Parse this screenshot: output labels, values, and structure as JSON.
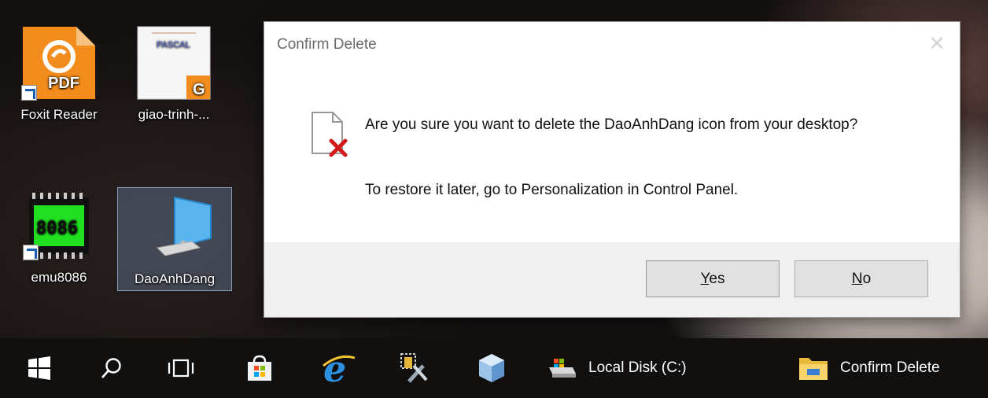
{
  "desktop": {
    "icons": [
      {
        "label": "Foxit Reader",
        "icon": "foxit-pdf-icon"
      },
      {
        "label": "giao-trinh-...",
        "icon": "document-thumbnail-icon",
        "thumb_text": "PASCAL"
      },
      {
        "label": "emu8086",
        "icon": "chip-8086-icon",
        "chip_text": "8086"
      },
      {
        "label": "DaoAnhDang",
        "icon": "computer-icon"
      }
    ]
  },
  "dialog": {
    "title": "Confirm Delete",
    "close_icon": "close-icon",
    "message": "Are you sure you want to delete the DaoAnhDang icon from your desktop?",
    "message2": "To restore it later, go to Personalization in Control Panel.",
    "icon": "delete-file-icon",
    "buttons": {
      "yes_accel": "Y",
      "yes_rest": "es",
      "no_accel": "N",
      "no_rest": "o"
    }
  },
  "taskbar": {
    "items": [
      {
        "icon": "windows-start-icon"
      },
      {
        "icon": "search-icon"
      },
      {
        "icon": "task-view-icon"
      },
      {
        "icon": "store-icon"
      },
      {
        "icon": "internet-explorer-icon"
      },
      {
        "icon": "tools-icon"
      },
      {
        "icon": "cube-app-icon"
      },
      {
        "icon": "drive-icon",
        "label": "Local Disk (C:)"
      },
      {
        "icon": "folder-icon",
        "label": "Confirm Delete"
      }
    ]
  },
  "colors": {
    "dialog_footer": "#f0f0f0",
    "button_face": "#e1e1e1",
    "taskbar": "#120f0f",
    "delete_x": "#d11a1a"
  }
}
